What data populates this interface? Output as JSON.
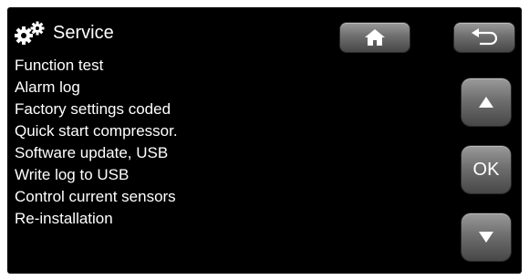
{
  "header": {
    "title": "Service",
    "icon": "gears-icon"
  },
  "menu": {
    "items": [
      {
        "label": "Function test"
      },
      {
        "label": "Alarm log"
      },
      {
        "label": "Factory settings coded"
      },
      {
        "label": "Quick start compressor."
      },
      {
        "label": "Software update, USB"
      },
      {
        "label": "Write log to USB"
      },
      {
        "label": "Control current sensors"
      },
      {
        "label": "Re-installation"
      }
    ]
  },
  "buttons": {
    "home_icon": "home-icon",
    "back_icon": "back-arrow-icon",
    "up_icon": "triangle-up-icon",
    "ok_label": "OK",
    "down_icon": "triangle-down-icon"
  },
  "colors": {
    "screen_bg": "#000000",
    "text": "#ffffff",
    "button": "#6f6f6f"
  }
}
